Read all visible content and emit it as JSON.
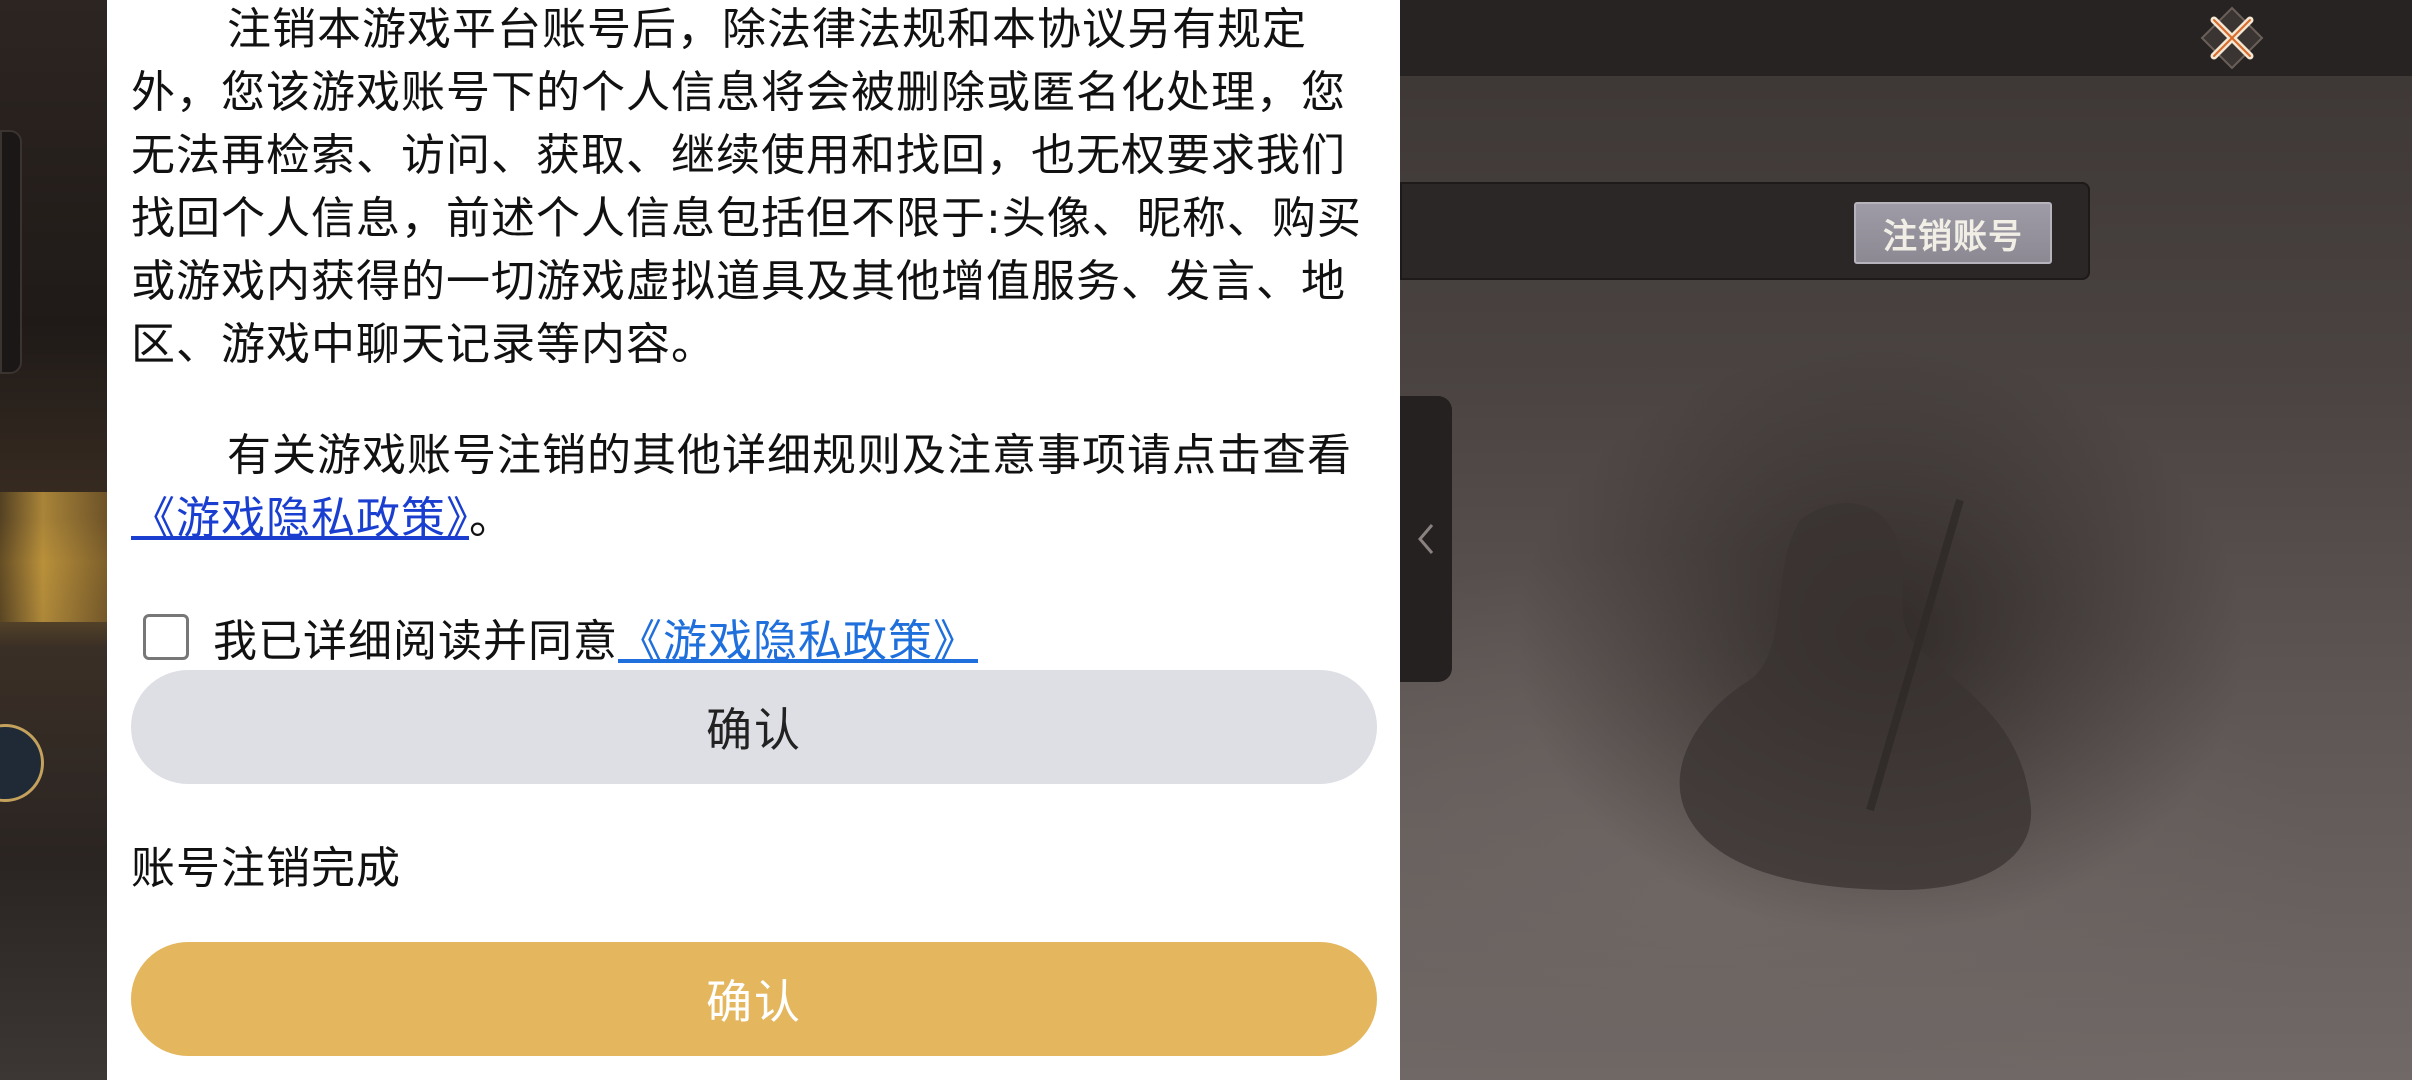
{
  "dialog": {
    "paragraph1": "注销本游戏平台账号后，除法律法规和本协议另有规定外，您该游戏账号下的个人信息将会被删除或匿名化处理，您无法再检索、访问、获取、继续使用和找回，也无权要求我们找回个人信息，前述个人信息包括但不限于:头像、昵称、购买或游戏内获得的一切游戏虚拟道具及其他增值服务、发言、地区、游戏中聊天记录等内容。",
    "paragraph2_prefix": "有关游戏账号注销的其他详细规则及注意事项请点击查看",
    "paragraph2_link": "《游戏隐私政策》",
    "paragraph2_suffix": "。",
    "agree_text": "我已详细阅读并同意",
    "agree_link": "《游戏隐私政策》",
    "confirm_button_1": "确认",
    "done_label": "账号注销完成",
    "confirm_button_2": "确认",
    "colors": {
      "link": "#1a3fd0",
      "confirm_primary": "#e4b75f",
      "confirm_secondary": "#dddfe5"
    }
  },
  "game": {
    "cancel_account_button": "注销账号",
    "close_icon": "close-x-icon",
    "side_tab_icon": "chevron-left-icon"
  }
}
